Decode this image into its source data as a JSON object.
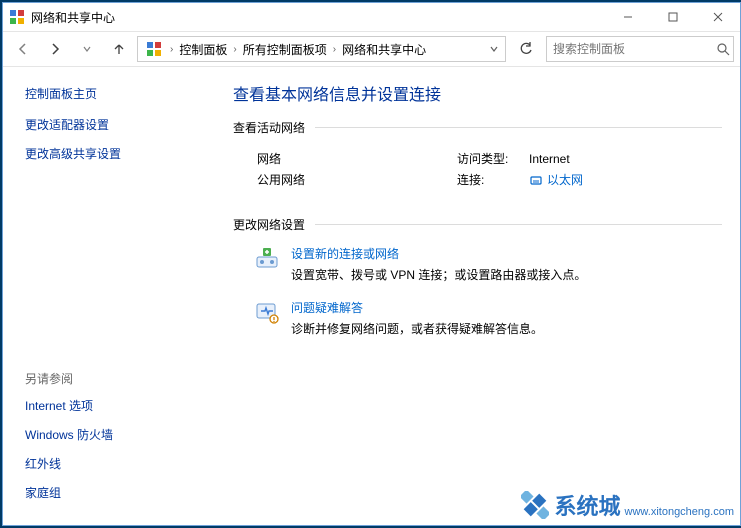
{
  "window": {
    "title": "网络和共享中心"
  },
  "breadcrumbs": {
    "items": [
      "控制面板",
      "所有控制面板项",
      "网络和共享中心"
    ]
  },
  "search": {
    "placeholder": "搜索控制面板"
  },
  "sidebar": {
    "home": "控制面板主页",
    "links": [
      "更改适配器设置",
      "更改高级共享设置"
    ],
    "see_also_title": "另请参阅",
    "see_also": [
      "Internet 选项",
      "Windows 防火墙",
      "红外线",
      "家庭组"
    ]
  },
  "content": {
    "page_title": "查看基本网络信息并设置连接",
    "active_section": "查看活动网络",
    "network": {
      "name": "网络",
      "type": "公用网络",
      "access_label": "访问类型:",
      "access_value": "Internet",
      "conn_label": "连接:",
      "conn_value": "以太网"
    },
    "change_section": "更改网络设置",
    "options": [
      {
        "title": "设置新的连接或网络",
        "desc": "设置宽带、拨号或 VPN 连接；或设置路由器或接入点。"
      },
      {
        "title": "问题疑难解答",
        "desc": "诊断并修复网络问题，或者获得疑难解答信息。"
      }
    ]
  },
  "watermark": {
    "brand": "系统城",
    "url": "www.xitongcheng.com"
  }
}
